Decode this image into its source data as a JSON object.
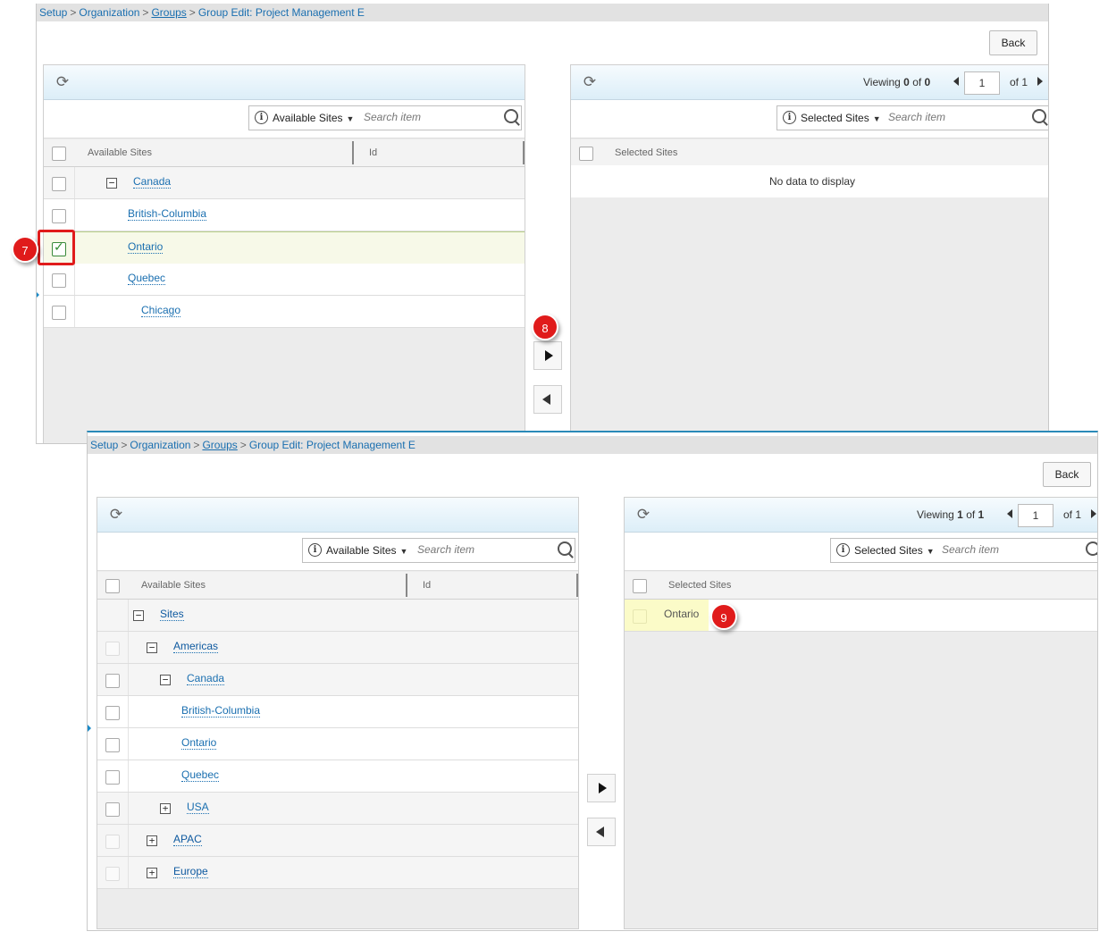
{
  "breadcrumb": {
    "setup": "Setup",
    "organization": "Organization",
    "groups": "Groups",
    "current": "Group Edit: Project Management E",
    "separator": ">"
  },
  "back_label": "Back",
  "step1": {
    "available": {
      "selector_label": "Available Sites",
      "search_placeholder": "Search item",
      "col_name": "Available Sites",
      "col_id": "Id",
      "rows": [
        {
          "label": "Canada",
          "toggle": "−"
        },
        {
          "label": "British-Columbia"
        },
        {
          "label": "Ontario"
        },
        {
          "label": "Quebec"
        },
        {
          "label": "Chicago"
        }
      ]
    },
    "selected": {
      "viewing_prefix": "Viewing",
      "viewing_from": "0",
      "viewing_of": "of",
      "viewing_to": "0",
      "page": "1",
      "of_pages": "of 1",
      "selector_label": "Selected Sites",
      "search_placeholder": "Search item",
      "col_name": "Selected Sites",
      "empty_text": "No data to display"
    }
  },
  "step2": {
    "available": {
      "selector_label": "Available Sites",
      "search_placeholder": "Search item",
      "col_name": "Available Sites",
      "col_id": "Id",
      "rows": [
        {
          "label": "Sites",
          "toggle": "−"
        },
        {
          "label": "Americas",
          "toggle": "−"
        },
        {
          "label": "Canada",
          "toggle": "−"
        },
        {
          "label": "British-Columbia"
        },
        {
          "label": "Ontario"
        },
        {
          "label": "Quebec"
        },
        {
          "label": "USA",
          "toggle": "+"
        },
        {
          "label": "APAC",
          "toggle": "+"
        },
        {
          "label": "Europe",
          "toggle": "+"
        }
      ]
    },
    "selected": {
      "viewing_prefix": "Viewing",
      "viewing_from": "1",
      "viewing_of": "of",
      "viewing_to": "1",
      "page": "1",
      "of_pages": "of 1",
      "selector_label": "Selected Sites",
      "search_placeholder": "Search item",
      "col_name": "Selected Sites",
      "rows": [
        {
          "label": "Ontario"
        }
      ]
    }
  },
  "badges": {
    "step7": "7",
    "step8": "8",
    "step9": "9"
  },
  "colors": {
    "link": "#1a6fb0",
    "badge": "#e01b1b",
    "selected_row": "#f7f9e8",
    "highlight": "#fbfbc8"
  }
}
